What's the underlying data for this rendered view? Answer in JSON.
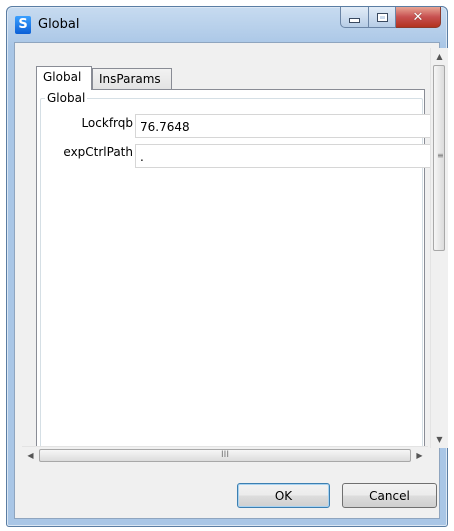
{
  "window": {
    "title": "Global",
    "icon": "s-app-icon",
    "controls": [
      "minimize-icon",
      "maximize-icon",
      "close-icon"
    ]
  },
  "tabs": [
    {
      "label": "Global",
      "selected": true
    },
    {
      "label": "InsParams",
      "selected": false
    }
  ],
  "group": {
    "title": "Global",
    "fields": [
      {
        "label": "Lockfrqb",
        "value": "76.7648"
      },
      {
        "label": "expCtrlPath",
        "value": "."
      }
    ]
  },
  "buttons": {
    "ok": "OK",
    "cancel": "Cancel"
  },
  "scroll": {
    "horizontal_grip": "III",
    "vertical_grip": "≡"
  }
}
